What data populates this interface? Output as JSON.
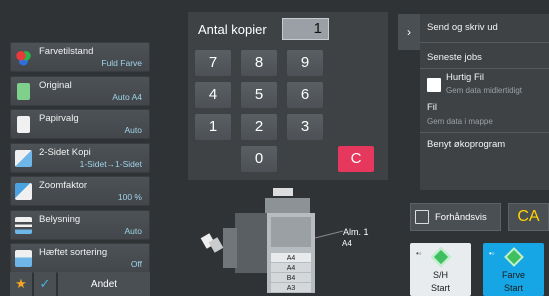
{
  "settings": [
    {
      "label": "Farvetilstand",
      "value": "Fuld Farve",
      "icon": "color-mode-icon"
    },
    {
      "label": "Original",
      "value": "Auto A4",
      "icon": "original-document-icon"
    },
    {
      "label": "Papirvalg",
      "value": "Auto",
      "icon": "paper-select-icon"
    },
    {
      "label": "2-Sidet Kopi",
      "value": "1-Sidet→1-Sidet",
      "icon": "duplex-icon"
    },
    {
      "label": "Zoomfaktor",
      "value": "100 %",
      "icon": "zoom-icon"
    },
    {
      "label": "Belysning",
      "value": "Auto",
      "icon": "exposure-icon"
    },
    {
      "label": "Hæftet sortering",
      "value": "Off",
      "icon": "staple-sort-icon"
    }
  ],
  "bottom": {
    "favorite_icon": "★",
    "check_icon": "✓",
    "andet": "Andet"
  },
  "keypad": {
    "label": "Antal kopier",
    "count": "1",
    "keys": [
      "7",
      "8",
      "9",
      "4",
      "5",
      "6",
      "1",
      "2",
      "3",
      "0"
    ],
    "clear": "C"
  },
  "menu": {
    "toggle": "›",
    "send_print": "Send og skriv ud",
    "recent_jobs": "Seneste jobs",
    "quick_file": "Hurtig Fil",
    "quick_file_sub": "Gem data midlertidigt",
    "file": "Fil",
    "file_sub": "Gem data i mappe",
    "eco": "Benyt økoprogram"
  },
  "preview": {
    "label": "Forhåndsvis"
  },
  "ca": {
    "label": "CA"
  },
  "start_bw": {
    "line1": "S/H",
    "line2": "Start"
  },
  "start_color": {
    "line1": "Farve",
    "line2": "Start"
  },
  "machine": {
    "tray_label": "Alm. 1",
    "tray_size": "A4",
    "drawer_labels": [
      "A4",
      "A4",
      "B4",
      "A3"
    ]
  },
  "colors": {
    "accent": "#16a6e5",
    "clear": "#e6375c",
    "ca": "#ffd400",
    "value_text": "#9fd4ea"
  }
}
